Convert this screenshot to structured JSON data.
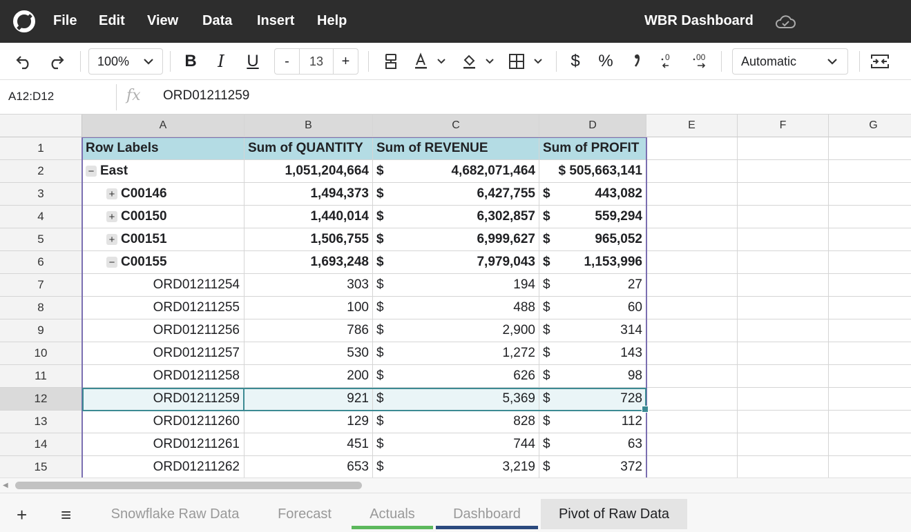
{
  "app": {
    "title": "WBR Dashboard",
    "menu": [
      "File",
      "Edit",
      "View",
      "Data",
      "Insert",
      "Help"
    ]
  },
  "toolbar": {
    "zoom": "100%",
    "font_size": "13",
    "font_size_minus": "-",
    "font_size_plus": "+",
    "number_format": "Automatic",
    "bold_label": "B",
    "italic_label": "I",
    "underline_label": "U",
    "currency_label": "$",
    "percent_label": "%"
  },
  "formula_bar": {
    "name_box": "A12:D12",
    "fx_label": "fx",
    "value": "ORD01211259"
  },
  "grid": {
    "columns": [
      "A",
      "B",
      "C",
      "D",
      "E",
      "F",
      "G"
    ],
    "row_numbers": [
      "1",
      "2",
      "3",
      "4",
      "5",
      "6",
      "7",
      "8",
      "9",
      "10",
      "11",
      "12",
      "13",
      "14",
      "15"
    ],
    "header": [
      "Row Labels",
      "Sum of QUANTITY",
      "Sum of REVENUE",
      "Sum of PROFIT"
    ],
    "rows": [
      {
        "label": "East",
        "toggle": "−",
        "level": 0,
        "bold": true,
        "qty": "1,051,204,664",
        "rev": "4,682,071,464",
        "profit": "$ 505,663,141",
        "profit_inline": true
      },
      {
        "label": "C00146",
        "toggle": "+",
        "level": 1,
        "bold": true,
        "qty": "1,494,373",
        "rev": "6,427,755",
        "profit": "443,082"
      },
      {
        "label": "C00150",
        "toggle": "+",
        "level": 1,
        "bold": true,
        "qty": "1,440,014",
        "rev": "6,302,857",
        "profit": "559,294"
      },
      {
        "label": "C00151",
        "toggle": "+",
        "level": 1,
        "bold": true,
        "qty": "1,506,755",
        "rev": "6,999,627",
        "profit": "965,052"
      },
      {
        "label": "C00155",
        "toggle": "−",
        "level": 1,
        "bold": true,
        "qty": "1,693,248",
        "rev": "7,979,043",
        "profit": "1,153,996"
      },
      {
        "label": "ORD01211254",
        "level": 2,
        "qty": "303",
        "rev": "194",
        "profit": "27"
      },
      {
        "label": "ORD01211255",
        "level": 2,
        "qty": "100",
        "rev": "488",
        "profit": "60"
      },
      {
        "label": "ORD01211256",
        "level": 2,
        "qty": "786",
        "rev": "2,900",
        "profit": "314"
      },
      {
        "label": "ORD01211257",
        "level": 2,
        "qty": "530",
        "rev": "1,272",
        "profit": "143"
      },
      {
        "label": "ORD01211258",
        "level": 2,
        "qty": "200",
        "rev": "626",
        "profit": "98"
      },
      {
        "label": "ORD01211259",
        "level": 2,
        "qty": "921",
        "rev": "5,369",
        "profit": "728",
        "selected": true
      },
      {
        "label": "ORD01211260",
        "level": 2,
        "qty": "129",
        "rev": "828",
        "profit": "112"
      },
      {
        "label": "ORD01211261",
        "level": 2,
        "qty": "451",
        "rev": "744",
        "profit": "63"
      },
      {
        "label": "ORD01211262",
        "level": 2,
        "qty": "653",
        "rev": "3,219",
        "profit": "372"
      }
    ],
    "currency_symbol": "$"
  },
  "sheets": {
    "add_label": "+",
    "list_label": "≡",
    "tabs": [
      {
        "label": "Snowflake Raw Data",
        "active": false,
        "color": ""
      },
      {
        "label": "Forecast",
        "active": false,
        "color": ""
      },
      {
        "label": "Actuals",
        "active": false,
        "color": "#5cb85c"
      },
      {
        "label": "Dashboard",
        "active": false,
        "color": "#2b4a7e"
      },
      {
        "label": "Pivot of Raw Data",
        "active": true,
        "color": ""
      }
    ]
  },
  "colors": {
    "titlebar": "#2d2d2d",
    "pivot_header": "#b4dce4",
    "selection": "#3c8a93",
    "pivot_border": "#7b6fb1"
  }
}
